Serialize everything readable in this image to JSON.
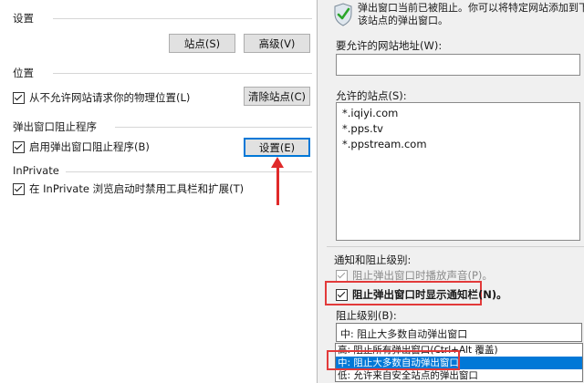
{
  "left": {
    "settings": {
      "title": "设置",
      "sites_button": "站点(S)",
      "advanced_button": "高级(V)"
    },
    "location": {
      "title": "位置",
      "checkbox_label": "从不允许网站请求你的物理位置(L)",
      "clear_sites_button": "清除站点(C)"
    },
    "popup_blocker": {
      "title": "弹出窗口阻止程序",
      "checkbox_label": "启用弹出窗口阻止程序(B)",
      "settings_button": "设置(E)"
    },
    "inprivate": {
      "title": "InPrivate",
      "checkbox_label": "在 InPrivate 浏览启动时禁用工具栏和扩展(T)"
    }
  },
  "right": {
    "info_text": {
      "line1": "弹出窗口当前已被阻止。你可以将特定网站添加到下表中",
      "line2": "该站点的弹出窗口。"
    },
    "address_label": "要允许的网站地址(W):",
    "address_value": "",
    "allowed_label": "允许的站点(S):",
    "allowed_sites": [
      "*.iqiyi.com",
      "*.pps.tv",
      "*.ppstream.com"
    ],
    "notify_section_label": "通知和阻止级别:",
    "play_sound_label": "阻止弹出窗口时播放声音(P)。",
    "show_bar_label": "阻止弹出窗口时显示通知栏(N)。",
    "level_label": "阻止级别(B):",
    "level_selected": "中: 阻止大多数自动弹出窗口",
    "level_options": [
      "高: 阻止所有弹出窗口(Ctrl+Alt 覆盖)",
      "中: 阻止大多数自动弹出窗口",
      "低: 允许来自安全站点的弹出窗口"
    ]
  },
  "colors": {
    "accent": "#0078d7",
    "annotation_red": "#e23a3a",
    "dialog_bg": "#f0f0f0"
  },
  "icons": {
    "info": "shield-check-icon",
    "annotation": "red-arrow-up-icon"
  }
}
